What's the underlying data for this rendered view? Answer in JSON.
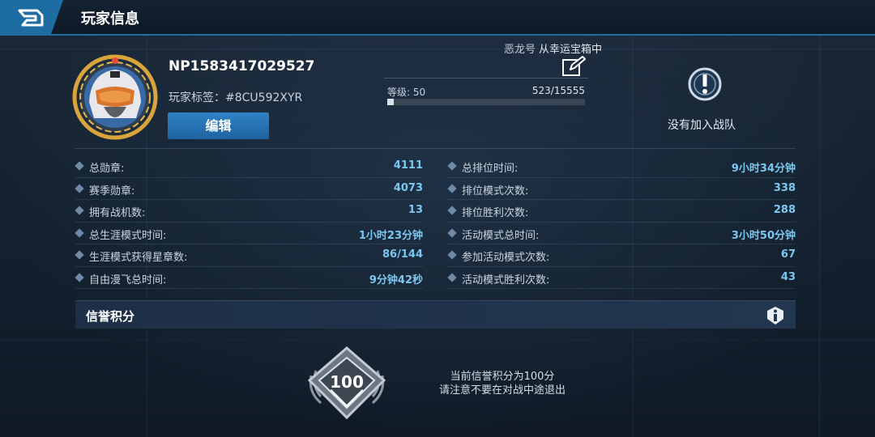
{
  "header": {
    "title": "玩家信息"
  },
  "profile": {
    "player_id": "NP1583417029527",
    "tag": "玩家标签：#8CU592XYR",
    "edit_label": "编辑",
    "ship_prefix": "恶龙号",
    "ship_name": "从幸运宝箱中",
    "level_label": "等级: 50",
    "xp_text": "523/15555",
    "xp_progress": 0.034,
    "team_text": "没有加入战队"
  },
  "stats_left": [
    {
      "label": "总勋章:",
      "value": "4111"
    },
    {
      "label": "赛季勋章:",
      "value": "4073"
    },
    {
      "label": "拥有战机数:",
      "value": "13"
    },
    {
      "label": "总生涯模式时间:",
      "value": "1小时23分钟"
    },
    {
      "label": "生涯模式获得星章数:",
      "value": "86/144"
    },
    {
      "label": "自由漫飞总时间:",
      "value": "9分钟42秒"
    }
  ],
  "stats_right": [
    {
      "label": "总排位时间:",
      "value": "9小时34分钟"
    },
    {
      "label": "排位模式次数:",
      "value": "338"
    },
    {
      "label": "排位胜利次数:",
      "value": "288"
    },
    {
      "label": "活动模式总时间:",
      "value": "3小时50分钟"
    },
    {
      "label": "参加活动模式次数:",
      "value": "67"
    },
    {
      "label": "活动模式胜利次数:",
      "value": "43"
    }
  ],
  "credit": {
    "title": "信誉积分",
    "score": "100",
    "line1": "当前信誉积分为100分",
    "line2": "请注意不要在对战中途退出"
  },
  "icons": {
    "back": "back-logo-icon",
    "edit_name": "pencil-edit-icon",
    "team_alert": "exclamation-badge-icon",
    "info": "info-shield-icon"
  },
  "colors": {
    "accent": "#1d6da3",
    "value_text": "#7cc7f0",
    "avatar_ring": "#d9a53a"
  }
}
